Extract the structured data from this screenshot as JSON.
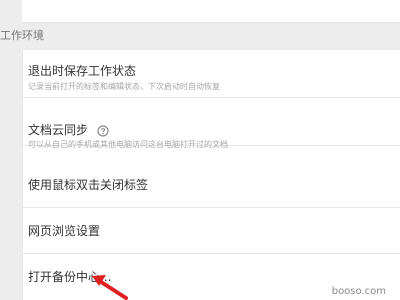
{
  "section": {
    "title": "工作环境"
  },
  "settings": {
    "items": [
      {
        "title": "退出时保存工作状态",
        "desc": "记录当前打开的标签和编辑状态，下次启动时自动恢复"
      },
      {
        "title": "文档云同步",
        "desc": "可以从自己的手机或其他电脑访问这台电脑打开过的文档",
        "icon": "help-icon"
      },
      {
        "title": "使用鼠标双击关闭标签"
      },
      {
        "title": "网页浏览设置"
      },
      {
        "title": "打开备份中心..."
      }
    ]
  },
  "annotation": {
    "icon": "arrow-icon",
    "color": "#e02020"
  },
  "watermark": {
    "text": "booso.com"
  }
}
